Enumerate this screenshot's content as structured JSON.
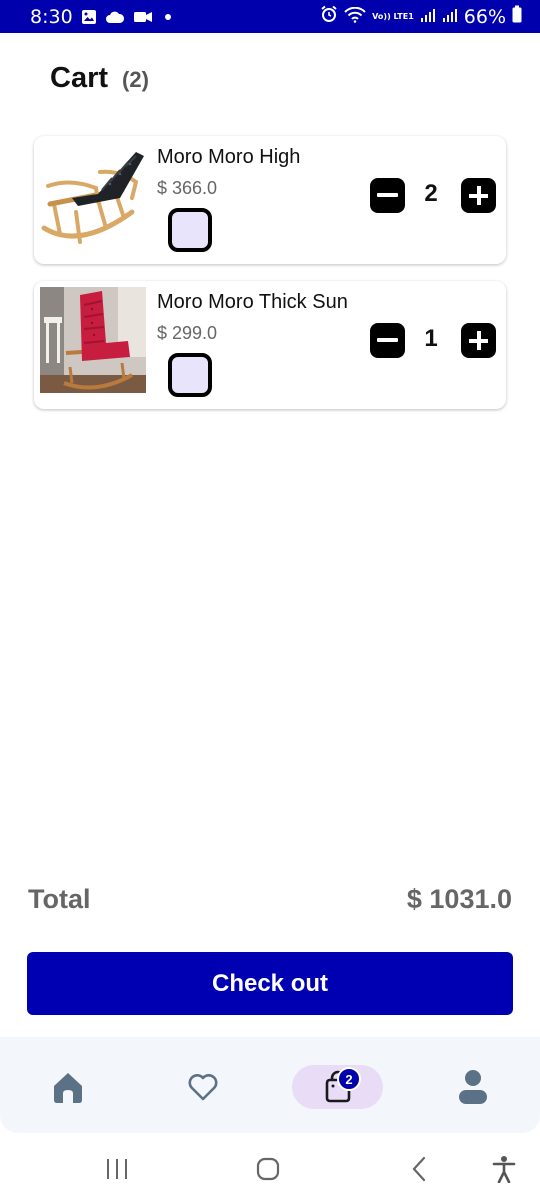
{
  "status_bar": {
    "time": "8:30",
    "battery": "66%",
    "lte": "Vo)) LTE1",
    "background_color": "#0000ad"
  },
  "header": {
    "title": "Cart",
    "count": "(2)"
  },
  "cart_items": [
    {
      "name": "Moro Moro High",
      "price": "$ 366.0",
      "quantity": "2",
      "image": "black-cushion-rocking-chair",
      "checked": false
    },
    {
      "name": "Moro Moro Thick Sun",
      "price": "$ 299.0",
      "quantity": "1",
      "image": "red-cushion-rocking-chair",
      "checked": false
    }
  ],
  "summary": {
    "total_label": "Total",
    "total_value": "$ 1031.0"
  },
  "checkout": {
    "label": "Check out",
    "color": "#0000b3"
  },
  "bottom_nav": {
    "items": [
      "home-icon",
      "heart-icon",
      "cart-bag-icon",
      "profile-icon"
    ],
    "active": "cart-bag-icon",
    "cart_badge": "2",
    "active_pill_color": "#e8dcf7"
  },
  "system_nav": {
    "items": [
      "recents-icon",
      "home-circle-icon",
      "back-icon",
      "accessibility-icon"
    ]
  }
}
